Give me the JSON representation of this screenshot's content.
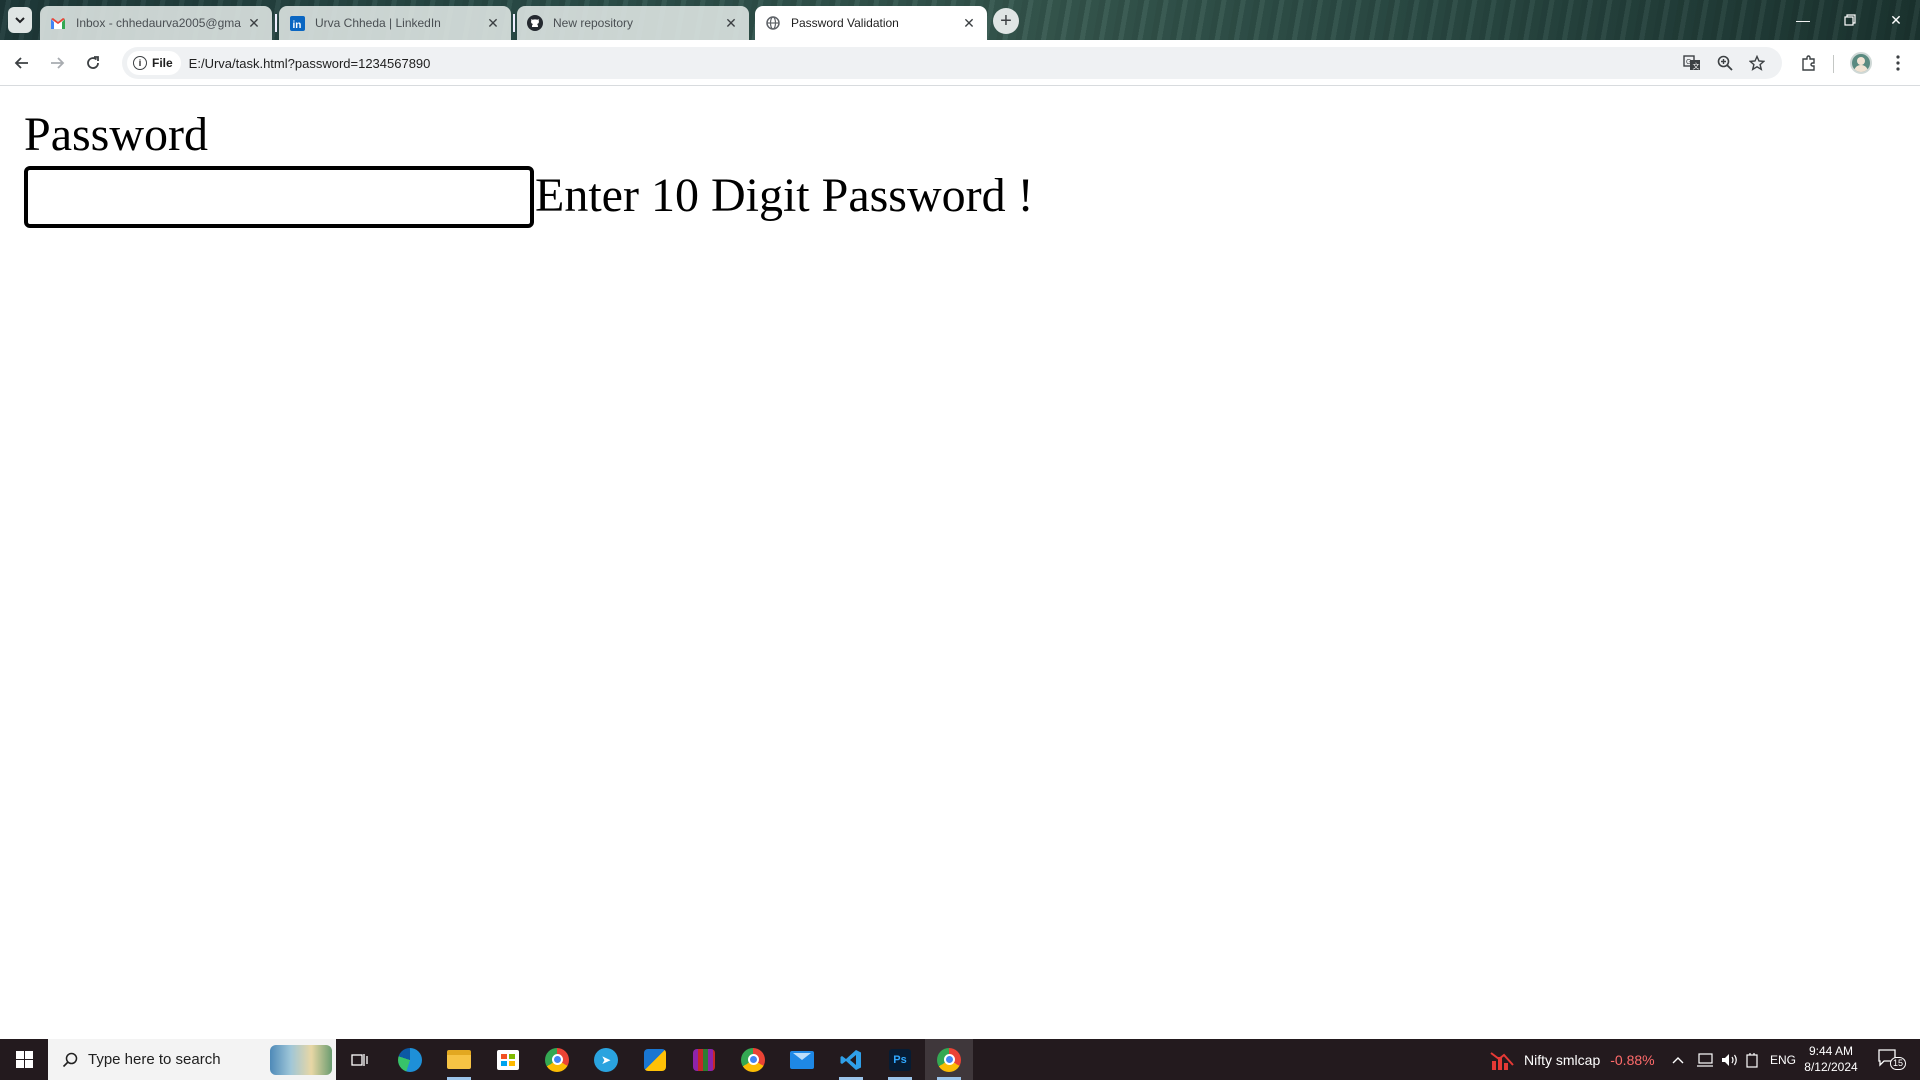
{
  "browser": {
    "tabs": [
      {
        "title": "Inbox - chhedaurva2005@gma",
        "favicon": "gmail-icon",
        "active": false
      },
      {
        "title": "Urva Chheda | LinkedIn",
        "favicon": "linkedin-icon",
        "active": false
      },
      {
        "title": "New repository",
        "favicon": "github-icon",
        "active": false
      },
      {
        "title": "Password Validation",
        "favicon": "globe-icon",
        "active": true
      }
    ],
    "address_chip": "File",
    "url": "E:/Urva/task.html?password=1234567890"
  },
  "page": {
    "label": "Password",
    "input_value": "",
    "message": "Enter 10 Digit Password !"
  },
  "taskbar": {
    "search_placeholder": "Type here to search",
    "widget_label": "Nifty smlcap",
    "widget_value": "-0.88%",
    "language": "ENG",
    "time": "9:44 AM",
    "date": "8/12/2024",
    "notification_count": "15"
  },
  "colors": {
    "accent_negative": "#ff6b6b",
    "taskbar_bg": "#231a1e"
  }
}
